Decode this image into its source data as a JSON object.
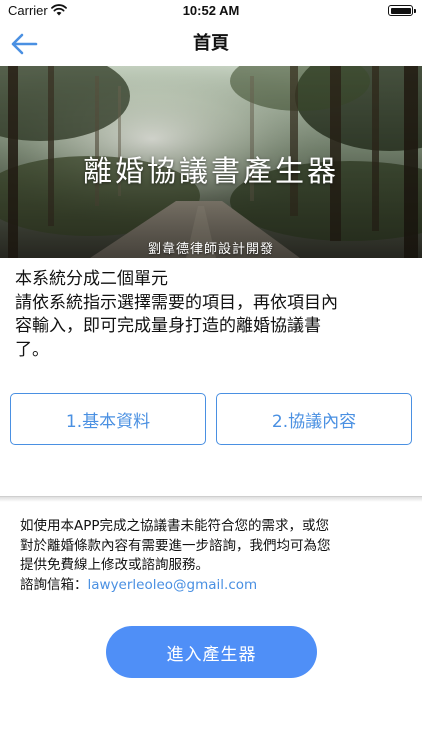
{
  "status_bar": {
    "carrier": "Carrier",
    "time": "10:52 AM"
  },
  "nav": {
    "title": "首頁"
  },
  "banner": {
    "title": "離婚協議書產生器",
    "subtitle": "劉韋德律師設計開發"
  },
  "intro": {
    "lines": [
      "本系統分成二個單元",
      "請依系統指示選擇需要的項目，再依項目內",
      "容輸入，即可完成量身打造的離婚協議書",
      "了。"
    ]
  },
  "units": {
    "basic_label": "1.基本資料",
    "agreement_label": "2.協議內容"
  },
  "notice": {
    "lines": [
      "如使用本APP完成之協議書未能符合您的需求，或您",
      "對於離婚條款內容有需要進一步諮詢，我們均可為您",
      "提供免費線上修改或諮詢服務。"
    ],
    "email_label": "諮詢信箱：",
    "email": "lawyerleoleo@gmail.com"
  },
  "enter_button": {
    "label": "進入產生器"
  },
  "colors": {
    "accent": "#4a90e2",
    "enter_button": "#4f8ff7"
  }
}
